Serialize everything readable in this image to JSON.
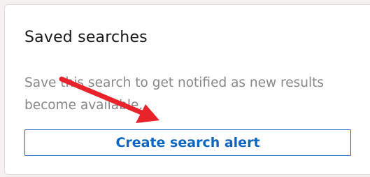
{
  "card": {
    "title": "Saved searches",
    "description": "Save this search to get notified as new results become available.",
    "button_label": "Create search alert"
  },
  "colors": {
    "accent": "#0a66c2",
    "annotation_arrow": "#e8232a"
  }
}
